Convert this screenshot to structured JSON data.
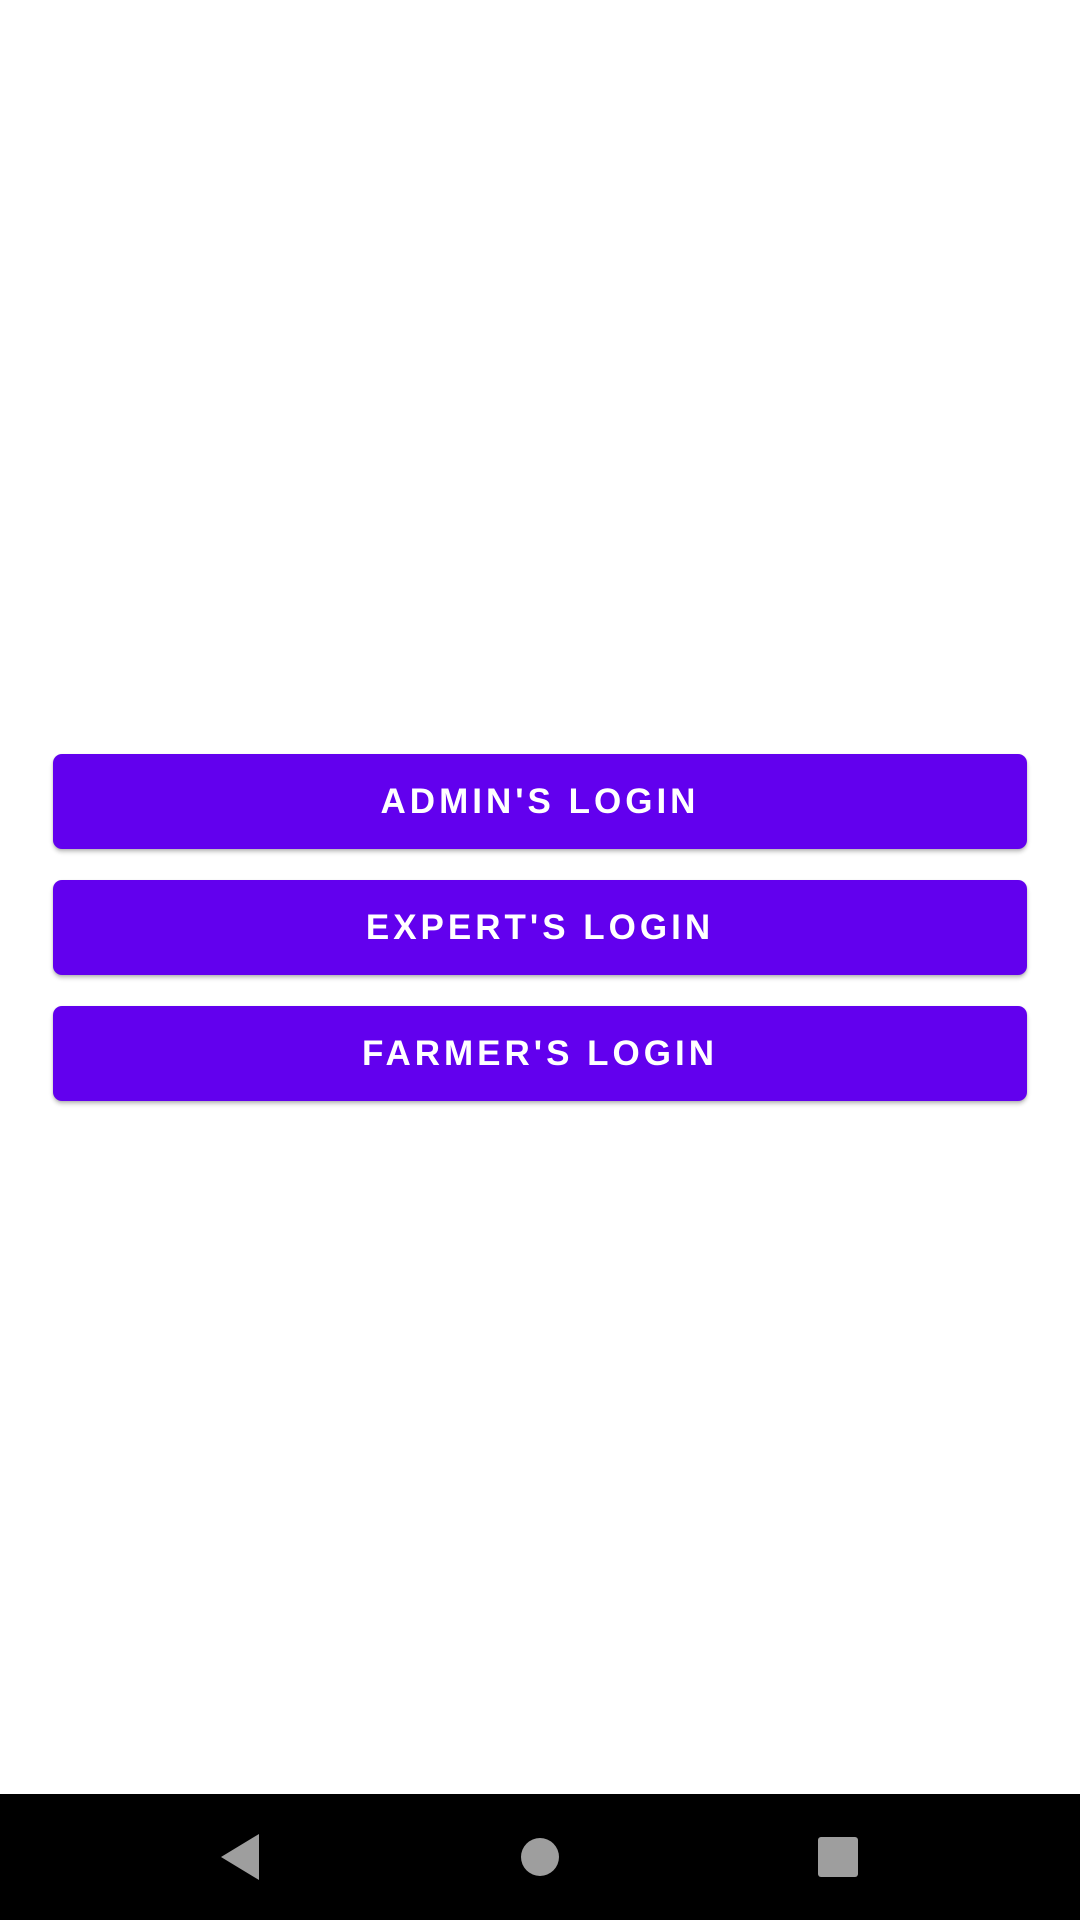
{
  "buttons": {
    "admin_label": "ADMIN'S LOGIN",
    "expert_label": "EXPERT'S LOGIN",
    "farmer_label": "FARMER'S LOGIN"
  },
  "colors": {
    "primary": "#6200ee",
    "button_text": "#ffffff",
    "background": "#ffffff",
    "nav_bar": "#000000",
    "nav_icon": "#9e9e9e"
  },
  "nav_bar": {
    "icons": [
      "back-icon",
      "home-icon",
      "recents-icon"
    ]
  }
}
